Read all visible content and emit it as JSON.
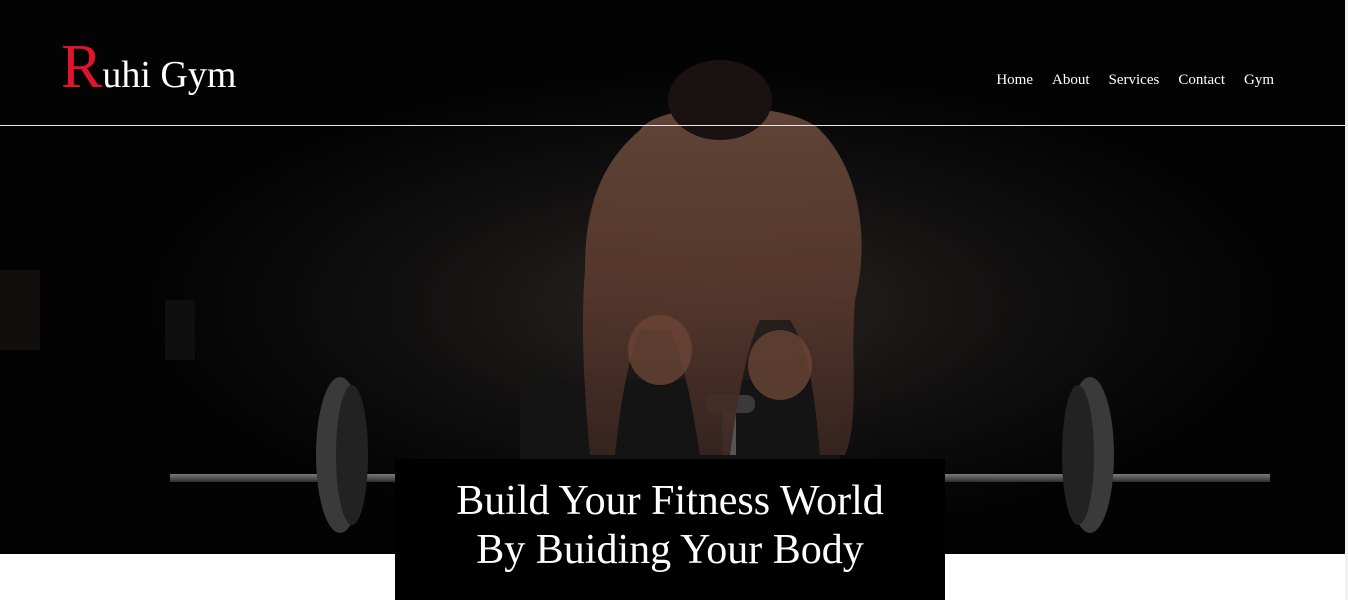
{
  "brand": {
    "initial": "R",
    "rest": "uhi Gym",
    "accent_color": "#e0142b"
  },
  "nav": {
    "items": [
      {
        "label": "Home"
      },
      {
        "label": "About"
      },
      {
        "label": "Services"
      },
      {
        "label": "Contact"
      },
      {
        "label": "Gym"
      }
    ]
  },
  "hero": {
    "image_subject": "athlete-deadlift-barbell-photo",
    "headline_line1": "Build Your Fitness World",
    "headline_line2": "By Buiding Your Body"
  },
  "colors": {
    "header_bg": "#000000",
    "text": "#ffffff",
    "page_bg": "#ffffff"
  }
}
